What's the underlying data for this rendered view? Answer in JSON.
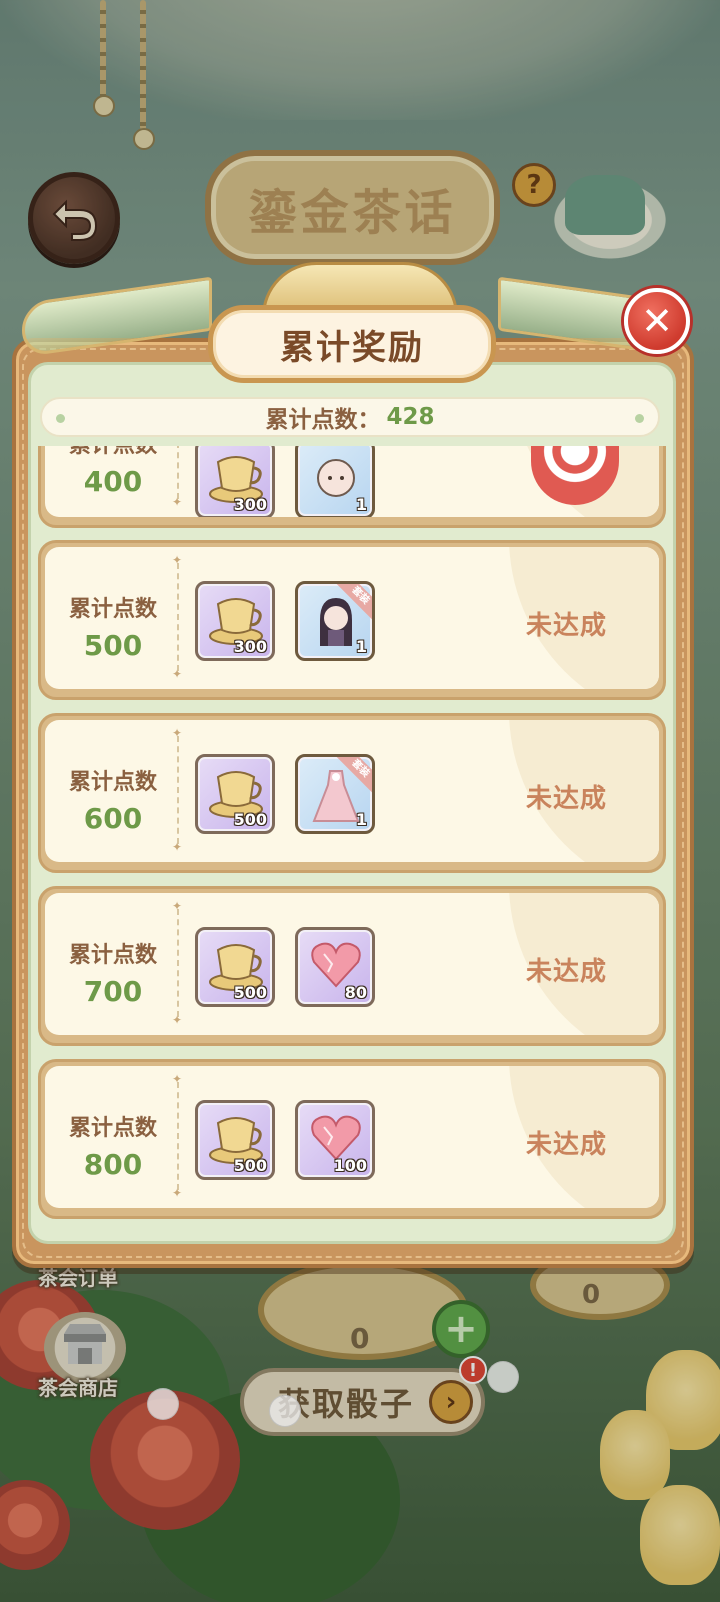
{
  "background": {
    "title": "鎏金茶话",
    "help_symbol": "?",
    "orders_label": "茶会订单",
    "shop_label": "茶会商店",
    "dice_label": "获取骰子",
    "dice_arrow": "›",
    "dice_badge": "!",
    "plus_symbol": "+",
    "left_count": "0",
    "right_count": "0"
  },
  "modal": {
    "title": "累计奖励",
    "close_symbol": "✕",
    "points_label": "累计点数：",
    "points_value": "428"
  },
  "rows": [
    {
      "label": "累计点数",
      "threshold": "400",
      "item1_qty": "300",
      "item2_qty": "1",
      "status": ""
    },
    {
      "label": "累计点数",
      "threshold": "500",
      "item1_qty": "300",
      "item2_qty": "1",
      "item2_tag": "套装",
      "status": "未达成"
    },
    {
      "label": "累计点数",
      "threshold": "600",
      "item1_qty": "500",
      "item2_qty": "1",
      "item2_tag": "套装",
      "status": "未达成"
    },
    {
      "label": "累计点数",
      "threshold": "700",
      "item1_qty": "500",
      "item2_qty": "80",
      "status": "未达成"
    },
    {
      "label": "累计点数",
      "threshold": "800",
      "item1_qty": "500",
      "item2_qty": "100",
      "status": "未达成"
    }
  ],
  "colors": {
    "accent_green": "#6e9a48",
    "label_brown": "#8a6040",
    "status_orange": "#c9835c",
    "close_red": "#cf3b2e"
  },
  "icons": {
    "back": "back-arrow-icon",
    "close": "close-icon",
    "teacup": "teacup-icon",
    "heart_gem": "heart-gem-icon"
  }
}
